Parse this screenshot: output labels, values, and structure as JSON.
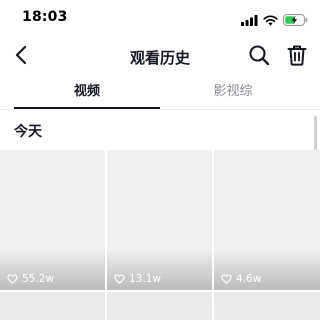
{
  "status_bar": {
    "time": "18:03",
    "icons": [
      "signal-icon",
      "wifi-icon",
      "battery-charging-icon"
    ],
    "battery_color": "#34c759"
  },
  "nav": {
    "title": "观看历史",
    "back_icon": "chevron-left-icon",
    "search_icon": "search-icon",
    "delete_icon": "trash-icon"
  },
  "tabs": [
    {
      "label": "视频",
      "active": true
    },
    {
      "label": "影视综",
      "active": false
    }
  ],
  "section": {
    "title": "今天"
  },
  "videos": [
    {
      "likes": "55.2w"
    },
    {
      "likes": "13.1w"
    },
    {
      "likes": "4.6w"
    },
    {
      "likes": ""
    },
    {
      "likes": ""
    },
    {
      "likes": ""
    }
  ],
  "colors": {
    "text_primary": "#161823",
    "text_secondary": "#8a8b91",
    "thumbnail_placeholder": "#f0f0f0"
  }
}
